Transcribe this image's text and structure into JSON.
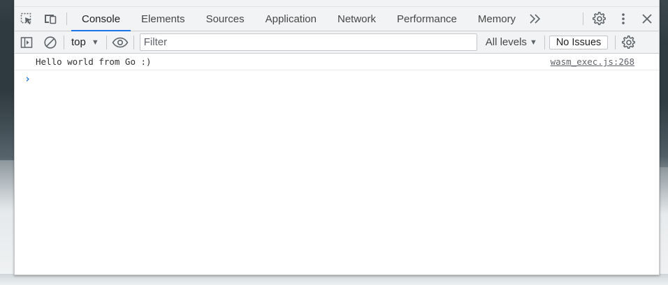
{
  "tabs": [
    {
      "label": "Console",
      "active": true
    },
    {
      "label": "Elements",
      "active": false
    },
    {
      "label": "Sources",
      "active": false
    },
    {
      "label": "Application",
      "active": false
    },
    {
      "label": "Network",
      "active": false
    },
    {
      "label": "Performance",
      "active": false
    },
    {
      "label": "Memory",
      "active": false
    }
  ],
  "toolbar": {
    "context": "top",
    "filter_placeholder": "Filter",
    "levels": "All levels",
    "issues": "No Issues"
  },
  "console": {
    "messages": [
      {
        "text": "Hello world from Go :)",
        "source": "wasm_exec.js:268"
      }
    ]
  },
  "colors": {
    "accent": "#1a73e8",
    "toolbar_bg": "#f1f3f4"
  },
  "icons": {
    "inspect": "inspect-element-icon",
    "device": "device-toolbar-icon",
    "more_tabs": "chevron-double-right-icon",
    "settings": "gear-icon",
    "kebab": "more-vert-icon",
    "close": "close-icon",
    "sidebar": "sidebar-toggle-icon",
    "clear": "clear-console-icon",
    "live": "eye-icon",
    "prompt": "chevron-right-icon"
  }
}
